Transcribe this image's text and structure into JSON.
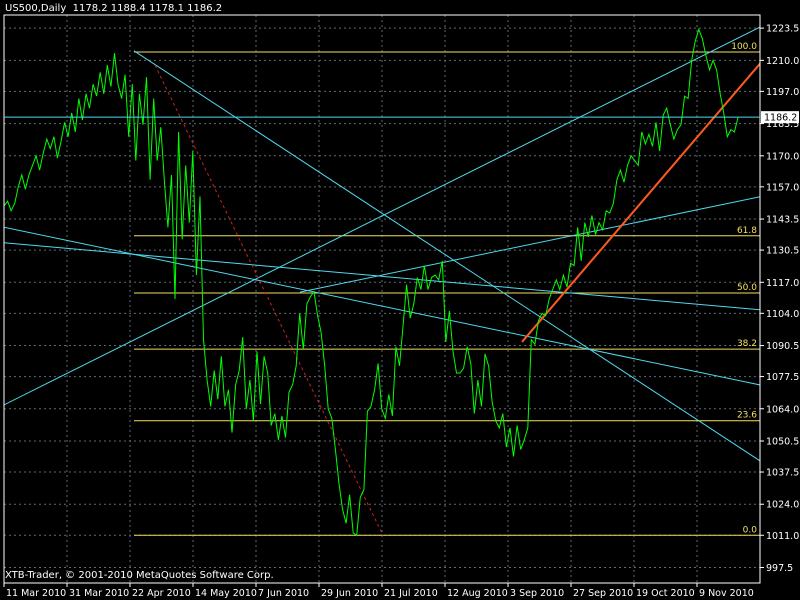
{
  "header": {
    "symbol": "US500,Daily",
    "ohlc": "1178.2 1188.4 1178.1 1186.2"
  },
  "footer": {
    "copyright": "XTB-Trader, © 2001-2010 MetaQuotes Software Corp."
  },
  "price_tag": "1186.2",
  "colors": {
    "background": "#000000",
    "frame": "#ffffff",
    "grid": "#5f6a73",
    "price_line": "#00ff00",
    "trend_cyan": "#4fd9ee",
    "trend_orange": "#ff5a1e",
    "fib_yellow": "#f0e060",
    "diag_red": "#cc2020",
    "text": "#ffffff",
    "fib_label": "#f0e060"
  },
  "chart_data": {
    "type": "line",
    "ylim": [
      991,
      1229
    ],
    "y_ticks": [
      "1223.5",
      "1210.0",
      "1197.0",
      "1183.5",
      "1170.0",
      "1157.0",
      "1143.5",
      "1130.5",
      "1117.0",
      "1104.0",
      "1090.5",
      "1077.5",
      "1064.0",
      "1050.5",
      "1037.5",
      "1024.0",
      "1011.0",
      "997.5"
    ],
    "x_ticks": [
      "11 Mar 2010",
      "31 Mar 2010",
      "22 Apr 2010",
      "14 May 2010",
      "7 Jun 2010",
      "29 Jun 2010",
      "21 Jul 2010",
      "12 Aug 2010",
      "3 Sep 2010",
      "27 Sep 2010",
      "19 Oct 2010",
      "9 Nov 2010"
    ],
    "current_price": 1186.2,
    "fibonacci": [
      {
        "label": "100.0",
        "value": 1213.5
      },
      {
        "label": "61.8",
        "value": 1136.5
      },
      {
        "label": "50.0",
        "value": 1112.5
      },
      {
        "label": "38.2",
        "value": 1089.0
      },
      {
        "label": "23.6",
        "value": 1059.0
      },
      {
        "label": "0.0",
        "value": 1011.0
      }
    ],
    "series": [
      {
        "values": [
          1149,
          1151,
          1147,
          1150,
          1157,
          1162,
          1156,
          1162,
          1166,
          1170,
          1164,
          1171,
          1177,
          1173,
          1178,
          1169,
          1176,
          1184,
          1178,
          1188,
          1180,
          1194,
          1185,
          1196,
          1190,
          1200,
          1195,
          1205,
          1196,
          1208,
          1199,
          1213,
          1200,
          1194,
          1204,
          1178,
          1200,
          1168,
          1196,
          1183,
          1203,
          1160,
          1194,
          1168,
          1182,
          1160,
          1140,
          1162,
          1110,
          1180,
          1135,
          1166,
          1142,
          1172,
          1120,
          1153,
          1093,
          1076,
          1065,
          1080,
          1068,
          1086,
          1065,
          1072,
          1054,
          1074,
          1080,
          1094,
          1064,
          1076,
          1059,
          1088,
          1066,
          1086,
          1079,
          1057,
          1062,
          1051,
          1061,
          1052,
          1071,
          1074,
          1082,
          1104,
          1089,
          1108,
          1111,
          1113,
          1103,
          1096,
          1082,
          1064,
          1060,
          1047,
          1033,
          1022,
          1016,
          1028,
          1012,
          1011,
          1027,
          1030,
          1063,
          1065,
          1072,
          1083,
          1064,
          1060,
          1070,
          1061,
          1090,
          1082,
          1099,
          1116,
          1102,
          1108,
          1119,
          1114,
          1124,
          1114,
          1119,
          1120,
          1118,
          1126,
          1092,
          1105,
          1088,
          1079,
          1079,
          1081,
          1090,
          1083,
          1062,
          1076,
          1065,
          1087,
          1082,
          1067,
          1059,
          1056,
          1062,
          1048,
          1056,
          1044,
          1057,
          1047,
          1051,
          1056,
          1093,
          1091,
          1101,
          1104,
          1103,
          1110,
          1114,
          1118,
          1114,
          1120,
          1115,
          1125,
          1124,
          1140,
          1126,
          1142,
          1136,
          1145,
          1137,
          1142,
          1139,
          1147,
          1146,
          1150,
          1160,
          1164,
          1159,
          1166,
          1170,
          1168,
          1166,
          1180,
          1175,
          1179,
          1174,
          1184,
          1172,
          1187,
          1190,
          1183,
          1177,
          1181,
          1183,
          1195,
          1194,
          1210,
          1218,
          1223,
          1219,
          1212,
          1206,
          1210,
          1206,
          1196,
          1188,
          1178,
          1181,
          1180,
          1186
        ]
      }
    ],
    "trendlines": [
      {
        "color": "trend_cyan",
        "points": [
          [
            0,
            1140.4
          ],
          [
            800,
            1070.5
          ]
        ]
      },
      {
        "color": "trend_cyan",
        "points": [
          [
            0,
            1133.7
          ],
          [
            800,
            1104.0
          ]
        ]
      },
      {
        "color": "trend_cyan",
        "points": [
          [
            0,
            1064.8
          ],
          [
            800,
            1232.3
          ]
        ]
      },
      {
        "color": "trend_cyan",
        "points": [
          [
            300,
            1112.9
          ],
          [
            800,
            1156.3
          ]
        ]
      },
      {
        "color": "trend_cyan",
        "points": [
          [
            134,
            1214.0
          ],
          [
            800,
            1031.2
          ]
        ]
      },
      {
        "color": "trend_orange",
        "points": [
          [
            522,
            1092.0
          ],
          [
            790,
            1223.3
          ]
        ]
      },
      {
        "color": "diag_red",
        "points": [
          [
            155,
            1208.0
          ],
          [
            383,
            1011.0
          ]
        ]
      }
    ]
  }
}
